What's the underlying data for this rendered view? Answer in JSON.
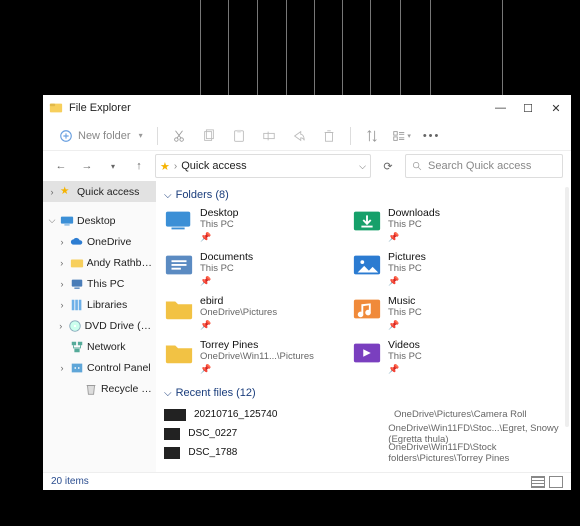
{
  "window": {
    "title": "File Explorer"
  },
  "toolbar": {
    "new_folder_label": "New folder"
  },
  "address": {
    "crumb": "Quick access"
  },
  "search": {
    "placeholder": "Search Quick access"
  },
  "sidebar": {
    "quick_access": "Quick access",
    "desktop": "Desktop",
    "onedrive": "OneDrive",
    "andy": "Andy Rathbone",
    "thispc": "This PC",
    "libraries": "Libraries",
    "dvd": "DVD Drive (D:) ESD",
    "network": "Network",
    "controlpanel": "Control Panel",
    "recyclebin": "Recycle Bin"
  },
  "sections": {
    "folders": "Folders (8)",
    "recent": "Recent files (12)"
  },
  "folders": [
    {
      "name": "Desktop",
      "loc": "This PC"
    },
    {
      "name": "Downloads",
      "loc": "This PC"
    },
    {
      "name": "Documents",
      "loc": "This PC"
    },
    {
      "name": "Pictures",
      "loc": "This PC"
    },
    {
      "name": "ebird",
      "loc": "OneDrive\\Pictures"
    },
    {
      "name": "Music",
      "loc": "This PC"
    },
    {
      "name": "Torrey Pines",
      "loc": "OneDrive\\Win11...\\Pictures"
    },
    {
      "name": "Videos",
      "loc": "This PC"
    }
  ],
  "recent": [
    {
      "name": "20210716_125740",
      "path": "OneDrive\\Pictures\\Camera Roll"
    },
    {
      "name": "DSC_0227",
      "path": "OneDrive\\Win11FD\\Stoc...\\Egret, Snowy (Egretta thula)"
    },
    {
      "name": "DSC_1788",
      "path": "OneDrive\\Win11FD\\Stock folders\\Pictures\\Torrey Pines"
    }
  ],
  "status": {
    "count": "20 items"
  },
  "icon_colors": {
    "desktop": "#3b8fd6",
    "downloads": "#16a06a",
    "documents": "#5b8bc2",
    "pictures": "#2b7bd1",
    "ebird": "#f2c244",
    "music": "#f08a3a",
    "torrey": "#f2c244",
    "videos": "#7a3fbf"
  }
}
